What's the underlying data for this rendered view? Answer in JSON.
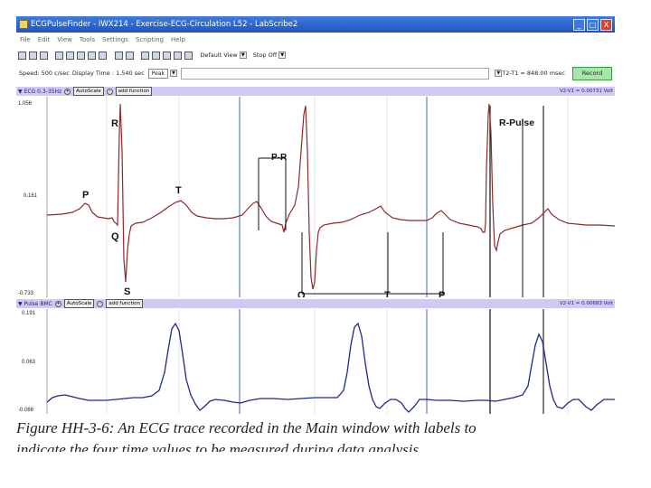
{
  "window": {
    "title": "ECGPulseFinder - IWX214 - Exercise-ECG-Circulation L52 - LabScribe2",
    "buttons": [
      "_",
      "□",
      "X"
    ]
  },
  "menu": [
    "File",
    "Edit",
    "View",
    "Tools",
    "Settings",
    "Scripting",
    "Help"
  ],
  "toolbar": {
    "default_view": "Default View",
    "stop_off": "Stop Off"
  },
  "speed_bar": {
    "speed": "Speed: 500 c/sec",
    "display_time": "Display Time : 1.540 sec",
    "peak": "Peak",
    "t2t1": "T2-T1 = 848.00 msec",
    "record": "Record"
  },
  "ecg_channel": {
    "name": "ECG 0.3-35Hz",
    "autoscale": "AutoScale",
    "add_function": "add function",
    "v2v1": "V2-V1 = 0.00731 Volt",
    "y_ticks": [
      "1.056",
      "0.161",
      "-0.733"
    ],
    "labels": {
      "p1": "P",
      "r": "R",
      "t1": "T",
      "q1": "Q",
      "s": "S",
      "pr": "P-R",
      "q2": "Q",
      "t2": "T",
      "p2": "P",
      "rpulse": "R-Pulse"
    }
  },
  "pulse_channel": {
    "name": "Pulse BMC",
    "autoscale": "AutoScale",
    "add_function": "add function",
    "v2v1": "V2-V1 = 0.00683 Volt",
    "y_ticks": [
      "0.191",
      "0.063",
      "-0.066"
    ]
  },
  "colors": {
    "ecg_trace": "#8b2a2a",
    "pulse_trace": "#1c2a8a",
    "cursor_line": "#4466bb",
    "channel_header": "#cfc9f4",
    "record_button": "#a7e6a8"
  },
  "caption": {
    "line1": "Figure HH-3-6: An ECG trace recorded in the Main window with labels to",
    "line2": "indicate the four time values to be measured during data analysis"
  }
}
